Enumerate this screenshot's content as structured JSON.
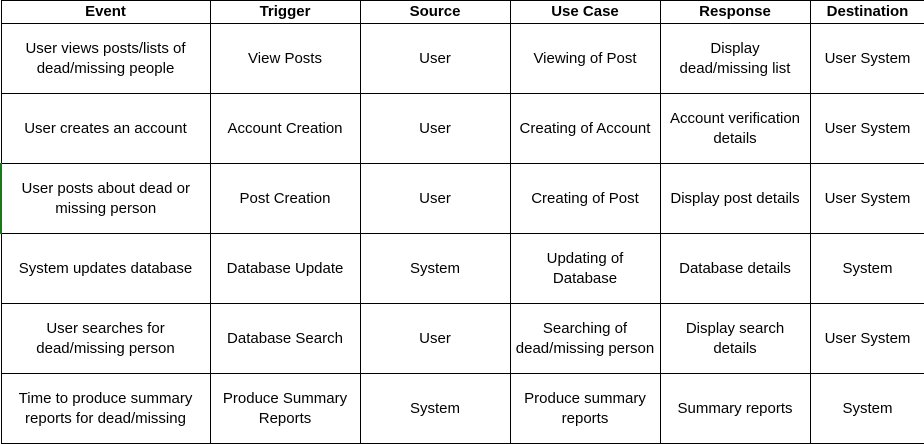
{
  "columns": [
    "Event",
    "Trigger",
    "Source",
    "Use Case",
    "Response",
    "Destination"
  ],
  "rows": [
    [
      "User views posts/lists of dead/missing people",
      "View Posts",
      "User",
      "Viewing of Post",
      "Display dead/missing list",
      "User System"
    ],
    [
      "User creates an account",
      "Account Creation",
      "User",
      "Creating of Account",
      "Account verification details",
      "User System"
    ],
    [
      "User posts about dead or missing person",
      "Post Creation",
      "User",
      "Creating of Post",
      "Display post details",
      "User System"
    ],
    [
      "System updates database",
      "Database Update",
      "System",
      "Updating of Database",
      "Database details",
      "System"
    ],
    [
      "User searches for dead/missing person",
      "Database Search",
      "User",
      "Searching of dead/missing person",
      "Display search details",
      "User System"
    ],
    [
      "Time to produce summary reports for dead/missing",
      "Produce Summary Reports",
      "System",
      "Produce summary reports",
      "Summary reports",
      "System"
    ]
  ]
}
